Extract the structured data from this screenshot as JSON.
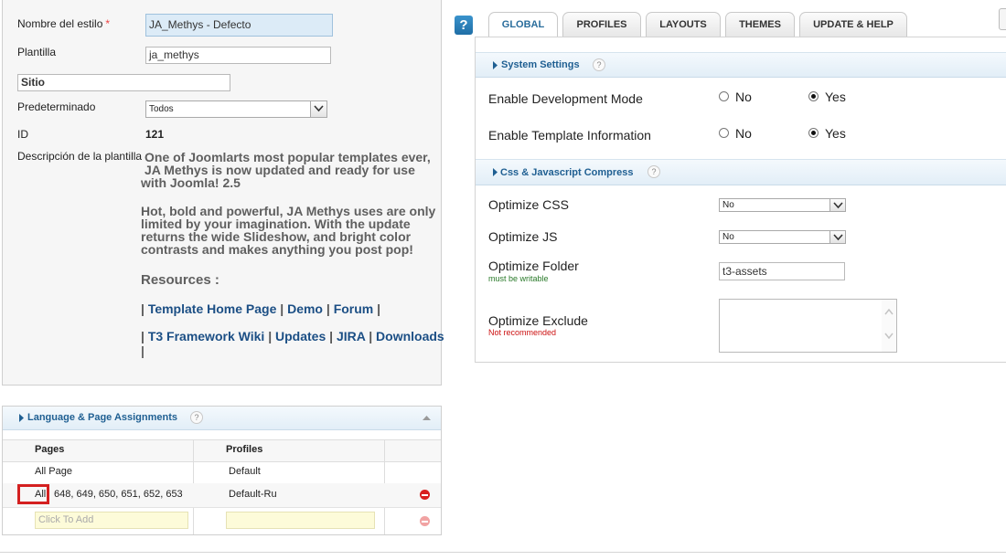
{
  "style_form": {
    "style_name_label": "Nombre del estilo",
    "required_mark": "*",
    "style_name_value": "JA_Methys - Defecto",
    "template_label": "Plantilla",
    "template_value": "ja_methys",
    "site_value": "Sitio",
    "default_label": "Predeterminado",
    "default_value": "Todos",
    "id_label": "ID",
    "id_value": "121",
    "description_label": "Descripción de la plantilla",
    "description": {
      "para1": [
        "One of Joomlarts most popular templates ever,",
        "JA Methys is now updated and ready for use",
        "with Joomla! 2.5"
      ],
      "para2": [
        "Hot, bold and powerful, JA Methys uses are only",
        "limited by your imagination. With the update",
        "returns the wide Slideshow, and bright color",
        "contrasts and makes anything you post pop!"
      ],
      "resources_heading": "Resources :",
      "links_row1": [
        "Template Home Page",
        "Demo",
        "Forum"
      ],
      "links_row2": [
        "T3 Framework Wiki",
        "Updates",
        "JIRA",
        "Downloads"
      ],
      "separator": "|"
    }
  },
  "assignments": {
    "title": "Language & Page Assignments",
    "help": "?",
    "columns": [
      "Pages",
      "Profiles"
    ],
    "rows": [
      {
        "page": "All Page",
        "profile": "Default"
      },
      {
        "page_prefix": "All",
        "page": "648, 649, 650, 651, 652, 653",
        "profile": "Default-Ru"
      }
    ],
    "add_placeholder": "Click To Add"
  },
  "toolbar": {
    "help_icon": "?"
  },
  "tabs": [
    "GLOBAL",
    "PROFILES",
    "LAYOUTS",
    "THEMES",
    "UPDATE & HELP"
  ],
  "active_tab": "GLOBAL",
  "system_settings": {
    "title": "System Settings",
    "help": "?",
    "fields": [
      {
        "label": "Enable Development Mode",
        "options": [
          "No",
          "Yes"
        ],
        "selected": "Yes"
      },
      {
        "label": "Enable Template Information",
        "options": [
          "No",
          "Yes"
        ],
        "selected": "Yes"
      }
    ]
  },
  "compress": {
    "title": "Css & Javascript Compress",
    "help": "?",
    "optimize_css_label": "Optimize CSS",
    "optimize_css_value": "No",
    "optimize_js_label": "Optimize JS",
    "optimize_js_value": "No",
    "optimize_folder_label": "Optimize Folder",
    "optimize_folder_note": "must be writable",
    "optimize_folder_value": "t3-assets",
    "optimize_exclude_label": "Optimize Exclude",
    "optimize_exclude_note": "Not recommended",
    "optimize_exclude_value": ""
  },
  "colors": {
    "highlight_box": "#d42020",
    "link": "#1c4f85",
    "accent": "#2a6d9c",
    "note_green": "#2a7a2a",
    "note_red": "#cc1111"
  }
}
